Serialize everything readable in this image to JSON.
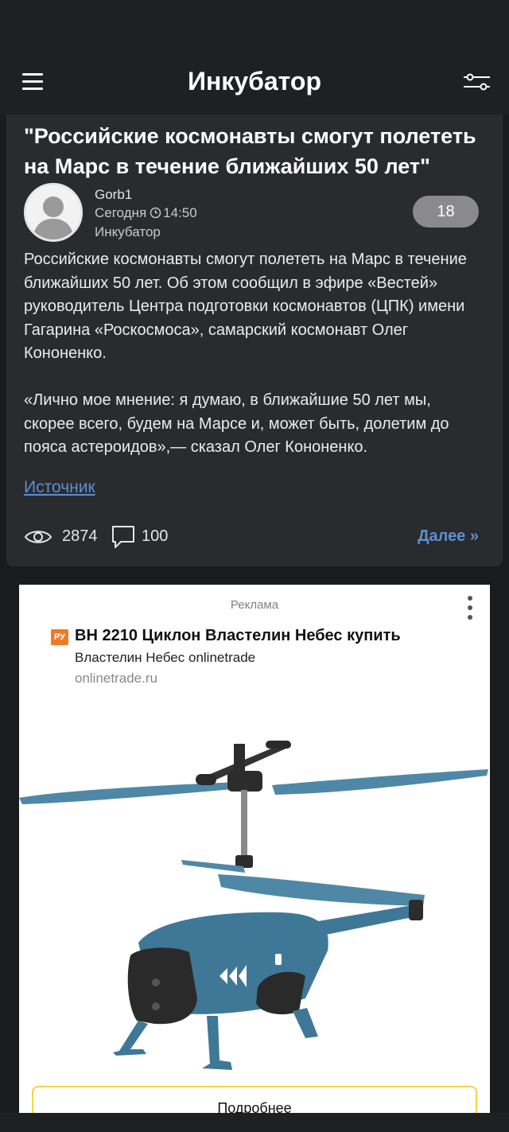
{
  "app_bar": {
    "title": "Инкубатор",
    "menu_icon": "hamburger-menu-icon",
    "filter_icon": "filter-sliders-icon"
  },
  "post": {
    "title": "\"Российские космонавты смогут полететь на Марс в течение ближайших 50 лет\"",
    "author": "Gorb1",
    "date_label": "Сегодня",
    "time": "14:50",
    "category": "Инкубатор",
    "rating": "18",
    "paragraphs": [
      "Российские космонавты смогут полететь на Марс в течение ближайших 50 лет. Об этом сообщил в эфире «Вестей» руководитель Центра подготовки космонавтов (ЦПК) имени Гагарина «Роскосмоса», самарский космонавт Олег Кононенко.",
      "«Лично мое мнение: я думаю, в ближайшие 50 лет мы, скорее всего, будем на Марсе и, может быть, долетим до пояса астероидов»,— сказал Олег Кононенко."
    ],
    "source_label": "Источник",
    "views": "2874",
    "comments": "100",
    "more_label": "Далее »"
  },
  "ad": {
    "label": "Реклама",
    "badge": "РУ",
    "title": "BH 2210 Циклон Властелин Небес купить",
    "subtitle": "Властелин Небес onlinetrade",
    "domain": "onlinetrade.ru",
    "cta_label": "Подробнее"
  },
  "colors": {
    "background": "#1a1b1d",
    "card": "#2a2b2e",
    "link": "#5d90d0",
    "rating_badge": "#8a8a8c",
    "ad_badge": "#f07a28",
    "ad_cta_border": "#f2d44a"
  }
}
